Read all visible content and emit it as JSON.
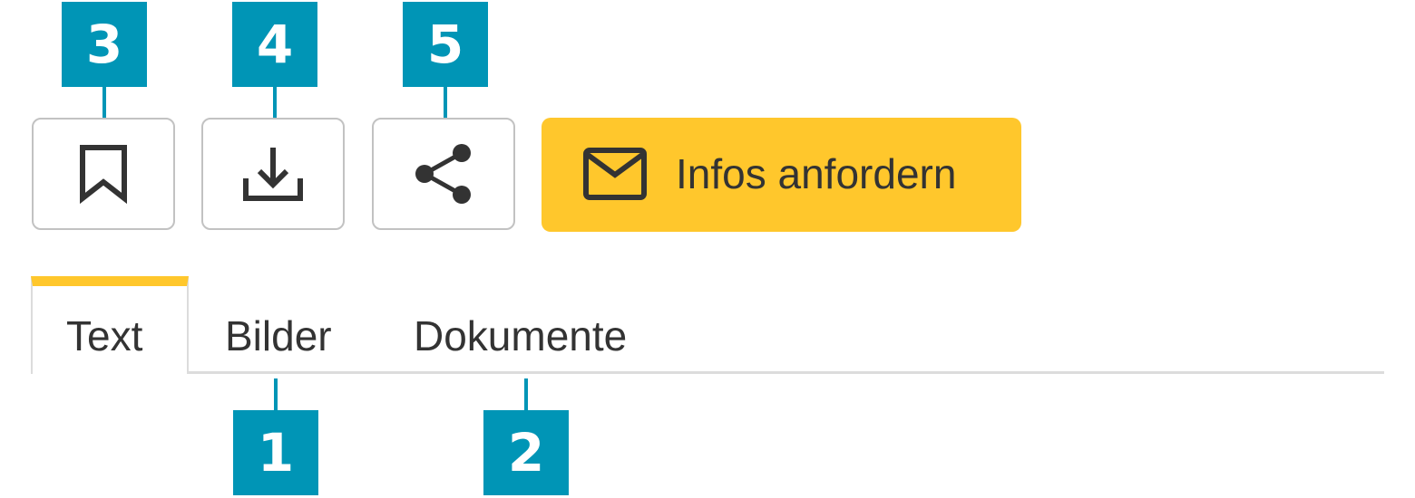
{
  "toolbar": {
    "bookmark_icon": "bookmark-icon",
    "download_icon": "download-icon",
    "share_icon": "share-icon",
    "cta": {
      "label": "Infos anfordern",
      "icon": "envelope-icon"
    }
  },
  "tabs": [
    {
      "label": "Text",
      "active": true
    },
    {
      "label": "Bilder",
      "active": false
    },
    {
      "label": "Dokumente",
      "active": false
    }
  ],
  "markers": {
    "m1": "1",
    "m2": "2",
    "m3": "3",
    "m4": "4",
    "m5": "5"
  },
  "colors": {
    "accent": "#ffc72c",
    "marker": "#0095b6",
    "text": "#333333",
    "border": "#c2c2c2"
  }
}
